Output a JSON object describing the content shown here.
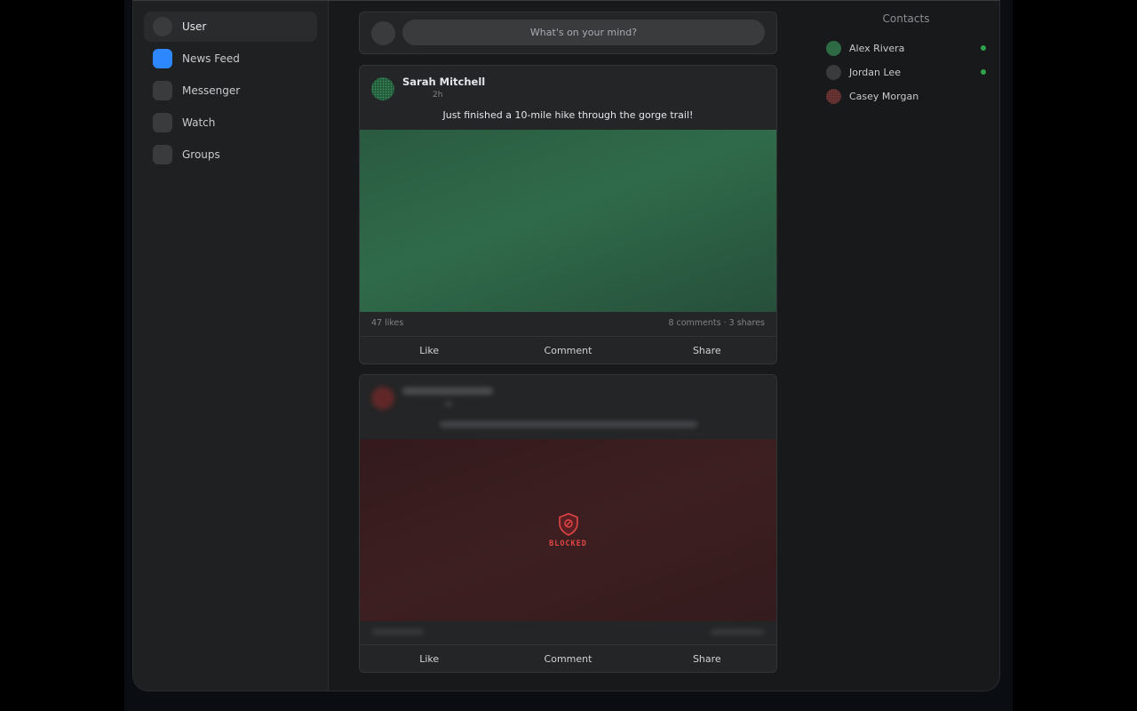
{
  "sidebar": {
    "items": [
      {
        "label": "User",
        "icon": "avatar-icon",
        "active": true
      },
      {
        "label": "News Feed",
        "icon": "news-feed-icon",
        "active": false
      },
      {
        "label": "Messenger",
        "icon": "messenger-icon",
        "active": false
      },
      {
        "label": "Watch",
        "icon": "watch-icon",
        "active": false
      },
      {
        "label": "Groups",
        "icon": "groups-icon",
        "active": false
      }
    ]
  },
  "composer": {
    "placeholder": "What's on your mind?"
  },
  "posts": [
    {
      "author": "Sarah Mitchell",
      "time": "2h",
      "text": "Just finished a 10-mile hike through the gorge trail!",
      "likes": "47 likes",
      "comments_shares": "8 comments · 3 shares",
      "avatar_color": "#2e7d4f",
      "media_color": "#2f6b4a"
    },
    {
      "blocked": true,
      "blocked_label": "BLOCKED",
      "avatar_color": "#8a2a2a",
      "media_color": "#3a1c1e"
    }
  ],
  "actions": {
    "like": "Like",
    "comment": "Comment",
    "share": "Share"
  },
  "contacts": {
    "title": "Contacts",
    "items": [
      {
        "name": "Alex Rivera",
        "online": true,
        "color": "#2e6b45"
      },
      {
        "name": "Jordan Lee",
        "online": true,
        "color": "#3a3b3c"
      },
      {
        "name": "Casey Morgan",
        "online": false,
        "color": "#6b3434"
      }
    ]
  },
  "colors": {
    "accent": "#2d88ff",
    "online": "#31a24c",
    "blocked": "#e24545"
  }
}
